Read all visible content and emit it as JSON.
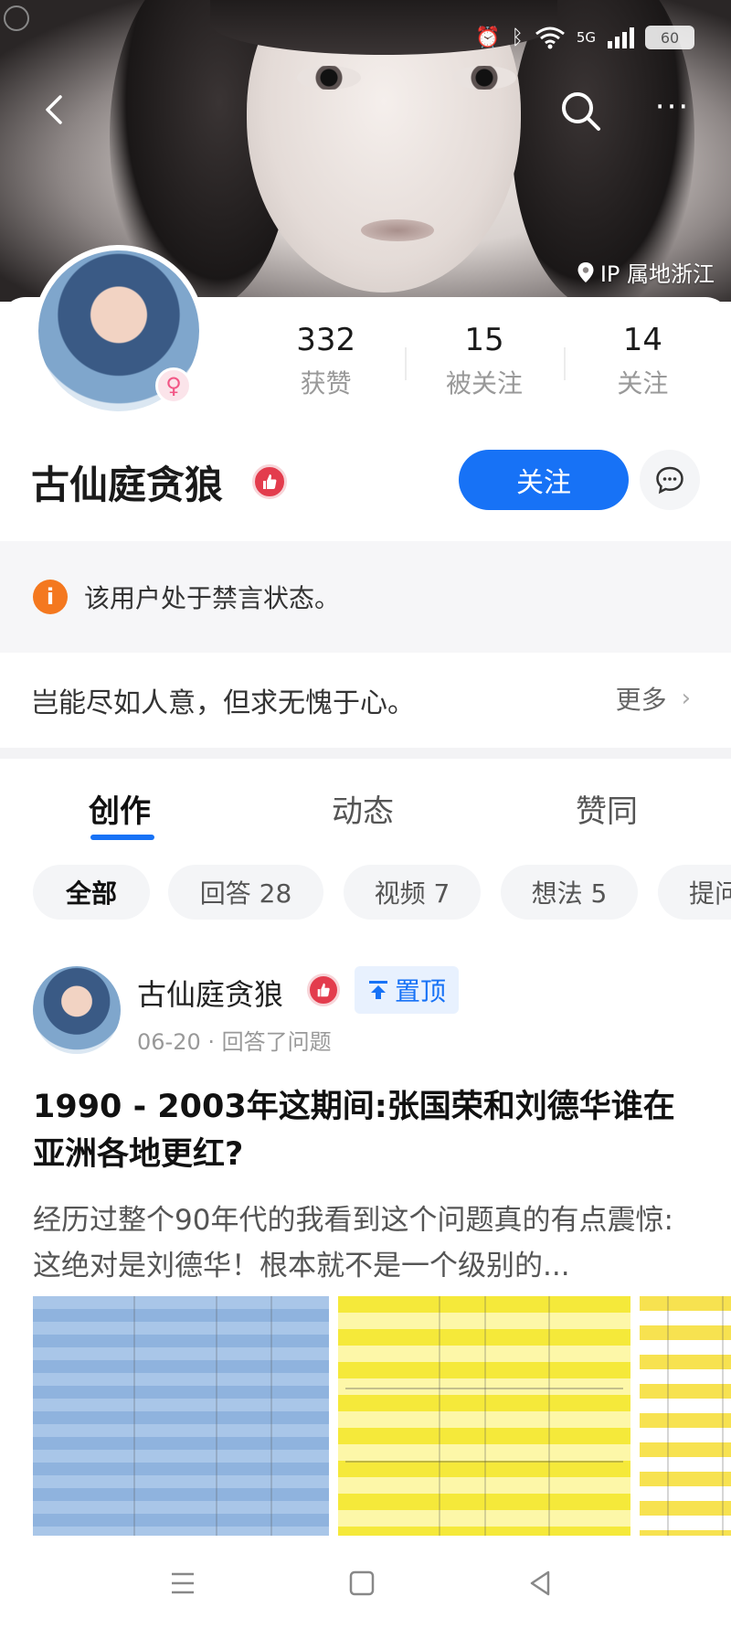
{
  "banner": {
    "ip_location": "IP 属地浙江"
  },
  "status_bar": {
    "network": "5G",
    "battery": "60"
  },
  "profile": {
    "stats": [
      {
        "value": "332",
        "label": "获赞"
      },
      {
        "value": "15",
        "label": "被关注"
      },
      {
        "value": "14",
        "label": "关注"
      }
    ],
    "username": "古仙庭贪狼",
    "follow_label": "关注",
    "gender_symbol": "♀"
  },
  "notice": {
    "text": "该用户处于禁言状态。"
  },
  "bio": {
    "text": "岂能尽如人意，但求无愧于心。",
    "more_label": "更多"
  },
  "tabs": [
    {
      "label": "创作",
      "active": true
    },
    {
      "label": "动态",
      "active": false
    },
    {
      "label": "赞同",
      "active": false
    }
  ],
  "filters": [
    {
      "label": "全部",
      "active": true
    },
    {
      "label": "回答 28",
      "active": false
    },
    {
      "label": "视频 7",
      "active": false
    },
    {
      "label": "想法 5",
      "active": false
    },
    {
      "label": "提问",
      "active": false
    }
  ],
  "feed_item": {
    "author": "古仙庭贪狼",
    "pinned_label": "置顶",
    "meta": "06-20 · 回答了问题",
    "title": "1990 - 2003年这期间:张国荣和刘德华谁在亚洲各地更红?",
    "excerpt": "经历过整个90年代的我看到这个问题真的有点震惊:这绝对是刘德华！根本就不是一个级别的..."
  },
  "colors": {
    "accent": "#1772f6",
    "notice_icon": "#f4781f",
    "verify_badge": "#e33c4d"
  }
}
